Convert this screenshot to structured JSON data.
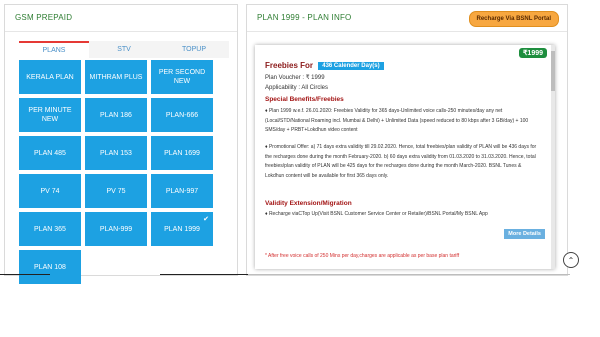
{
  "left": {
    "title": "GSM PREPAID",
    "tabs": [
      {
        "label": "PLANS",
        "active": true
      },
      {
        "label": "STV",
        "active": false
      },
      {
        "label": "TOPUP",
        "active": false
      }
    ],
    "plans": [
      {
        "label": "KERALA PLAN",
        "selected": false
      },
      {
        "label": "MITHRAM PLUS",
        "selected": false
      },
      {
        "label": "PER SECOND NEW",
        "selected": false
      },
      {
        "label": "PER MINUTE NEW",
        "selected": false
      },
      {
        "label": "PLAN 186",
        "selected": false
      },
      {
        "label": "PLAN-666",
        "selected": false
      },
      {
        "label": "PLAN 485",
        "selected": false
      },
      {
        "label": "PLAN 153",
        "selected": false
      },
      {
        "label": "PLAN 1699",
        "selected": false
      },
      {
        "label": "PV 74",
        "selected": false
      },
      {
        "label": "PV 75",
        "selected": false
      },
      {
        "label": "PLAN-997",
        "selected": false
      },
      {
        "label": "PLAN 365",
        "selected": false
      },
      {
        "label": "PLAN-999",
        "selected": false
      },
      {
        "label": "PLAN 1999",
        "selected": true
      },
      {
        "label": "PLAN 108",
        "selected": false
      }
    ]
  },
  "right": {
    "title": "PLAN 1999 - PLAN INFO",
    "recharge_label": "Recharge Via BSNL Portal",
    "card": {
      "price_badge": "₹1999",
      "freebies_label": "Freebies For",
      "days_pill": "436 Calender Day(s)",
      "plan_voucher": "Plan Voucher :  ₹  1999",
      "applicability": "Applicability :  All Circles",
      "special_heading": "Special Benefits/Freebies",
      "benefit_1": "♦ Plan 1999 w.e.f. 26.01.2020: Freebies Validity for 365 days-Unlimited voice calls-250 minutes/day any net (Local/STD/National Roaming incl. Mumbai & Delhi) + Unlimited Data (speed reduced to 80 kbps after 3 GB/day) + 100 SMS/day + PRBT+Lokdhun video content",
      "benefit_2": "♦ Promotional Offer: a) 71 days extra validity till 29.02.2020. Hence, total freebies/plan validity of PLAN will be 436 days for the recharges done during the month February-2020. b) 60 days extra validity from 01.03.2020 to 31.03.2020. Hence, total freebies/plan validity of PLAN will be 425 days for the recharges done during the month March-2020. BSNL Tunes & Lokdhun content will be available for first 365 days only.",
      "validity_heading": "Validity Extension/Migration",
      "validity_text": "♦ Recharge viaCTop Up(Visit BSNL Customer Service Center or Retailer)/BSNL Portal/My BSNL App",
      "more_label": "More Details",
      "footnote": "* After free voice calls of 250 Mins per day,charges are applicable as per base plan tariff"
    }
  },
  "icons": {
    "check": "✔",
    "scroll_up": "⌃"
  }
}
